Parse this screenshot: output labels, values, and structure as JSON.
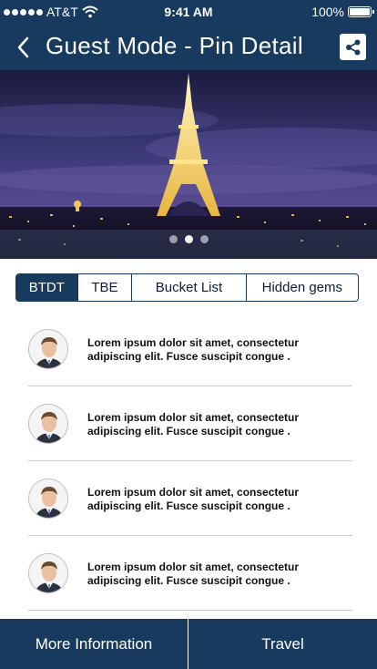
{
  "status_bar": {
    "carrier": "AT&T",
    "time": "9:41 AM",
    "battery": "100%",
    "battery_level": 1.0
  },
  "nav": {
    "title": "Guest Mode - Pin Detail",
    "back_icon": "chevron-left-icon",
    "share_icon": "share-icon"
  },
  "hero": {
    "page_count": 3,
    "active_page": 1
  },
  "tabs": [
    {
      "label": "BTDT",
      "active": true
    },
    {
      "label": "TBE",
      "active": false
    },
    {
      "label": "Bucket List",
      "active": false
    },
    {
      "label": "Hidden gems",
      "active": false
    }
  ],
  "list": [
    {
      "text": "Lorem ipsum dolor sit amet, consectetur adipiscing elit. Fusce suscipit congue ."
    },
    {
      "text": "Lorem ipsum dolor sit amet, consectetur adipiscing elit. Fusce suscipit congue ."
    },
    {
      "text": "Lorem ipsum dolor sit amet, consectetur adipiscing elit. Fusce suscipit congue ."
    },
    {
      "text": "Lorem ipsum dolor sit amet, consectetur adipiscing elit. Fusce suscipit congue ."
    }
  ],
  "bottom": {
    "more_info": "More Information",
    "travel": "Travel"
  },
  "colors": {
    "primary": "#173a5e",
    "background": "#ffffff"
  }
}
